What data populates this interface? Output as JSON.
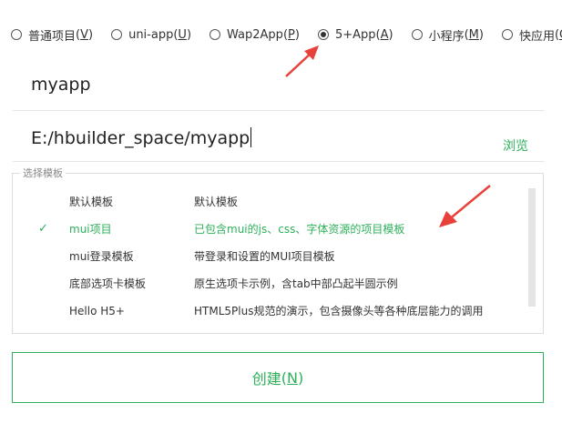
{
  "project_types": [
    {
      "label": "普通项目",
      "hotkey": "V",
      "checked": false
    },
    {
      "label": "uni-app",
      "hotkey": "U",
      "checked": false
    },
    {
      "label": "Wap2App",
      "hotkey": "P",
      "checked": false
    },
    {
      "label": "5+App",
      "hotkey": "A",
      "checked": true
    },
    {
      "label": "小程序",
      "hotkey": "M",
      "checked": false
    },
    {
      "label": "快应用",
      "hotkey": "Q",
      "checked": false
    }
  ],
  "project_name": "myapp",
  "project_path": "E:/hbuilder_space/myapp",
  "browse_label": "浏览",
  "template_group_label": "选择模板",
  "templates": [
    {
      "name": "默认模板",
      "description": "默认模板",
      "selected": false
    },
    {
      "name": "mui项目",
      "description": "已包含mui的js、css、字体资源的项目模板",
      "selected": true
    },
    {
      "name": "mui登录模板",
      "description": "带登录和设置的MUI项目模板",
      "selected": false
    },
    {
      "name": "底部选项卡模板",
      "description": "原生选项卡示例，含tab中部凸起半圆示例",
      "selected": false
    },
    {
      "name": "Hello H5+",
      "description": "HTML5Plus规范的演示，包含摄像头等各种底层能力的调用",
      "selected": false
    }
  ],
  "selected_check_icon": "check-icon",
  "create_button": {
    "label": "创建",
    "hotkey": "N"
  },
  "colors": {
    "accent": "#2cb05a",
    "annotation_arrow": "#e8413b"
  }
}
